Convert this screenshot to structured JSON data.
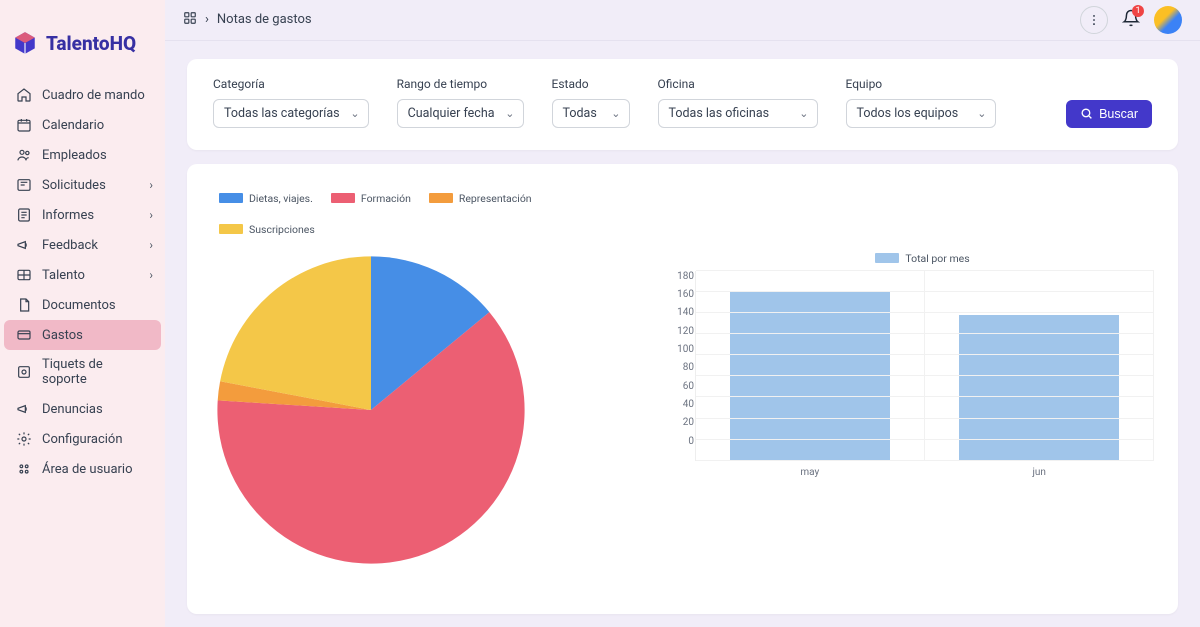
{
  "brand": "TalentoHQ",
  "breadcrumb": {
    "title": "Notas de gastos"
  },
  "notifications": {
    "count": "1"
  },
  "sidebar": {
    "items": [
      {
        "label": "Cuadro de mando",
        "icon": "home",
        "expandable": false
      },
      {
        "label": "Calendario",
        "icon": "calendar",
        "expandable": false
      },
      {
        "label": "Empleados",
        "icon": "users",
        "expandable": false
      },
      {
        "label": "Solicitudes",
        "icon": "inbox",
        "expandable": true
      },
      {
        "label": "Informes",
        "icon": "report",
        "expandable": true
      },
      {
        "label": "Feedback",
        "icon": "megaphone",
        "expandable": true
      },
      {
        "label": "Talento",
        "icon": "talent",
        "expandable": true
      },
      {
        "label": "Documentos",
        "icon": "document",
        "expandable": false
      },
      {
        "label": "Gastos",
        "icon": "card",
        "expandable": false,
        "active": true
      },
      {
        "label": "Tiquets de soporte",
        "icon": "ticket",
        "expandable": false
      },
      {
        "label": "Denuncias",
        "icon": "alert",
        "expandable": false
      },
      {
        "label": "Configuración",
        "icon": "gear",
        "expandable": false
      },
      {
        "label": "Área de usuario",
        "icon": "user-area",
        "expandable": false
      }
    ]
  },
  "filters": {
    "category": {
      "label": "Categoría",
      "value": "Todas las categorías"
    },
    "range": {
      "label": "Rango de tiempo",
      "value": "Cualquier fecha"
    },
    "state": {
      "label": "Estado",
      "value": "Todas"
    },
    "office": {
      "label": "Oficina",
      "value": "Todas las oficinas"
    },
    "team": {
      "label": "Equipo",
      "value": "Todos los equipos"
    },
    "search_label": "Buscar"
  },
  "chart_data": [
    {
      "type": "pie",
      "title": "",
      "series": [
        {
          "name": "Dietas, viajes.",
          "value": 14,
          "color": "#468ee6"
        },
        {
          "name": "Formación",
          "value": 62,
          "color": "#ec5f73"
        },
        {
          "name": "Representación",
          "value": 2,
          "color": "#f39c3d"
        },
        {
          "name": "Suscripciones",
          "value": 22,
          "color": "#f4c748"
        }
      ]
    },
    {
      "type": "bar",
      "title": "Total por mes",
      "ylim": [
        0,
        180
      ],
      "yticks": [
        0,
        20,
        40,
        60,
        80,
        100,
        120,
        140,
        160,
        180
      ],
      "categories": [
        "may",
        "jun"
      ],
      "values": [
        160,
        138
      ],
      "bar_color": "#a0c5ea"
    }
  ]
}
